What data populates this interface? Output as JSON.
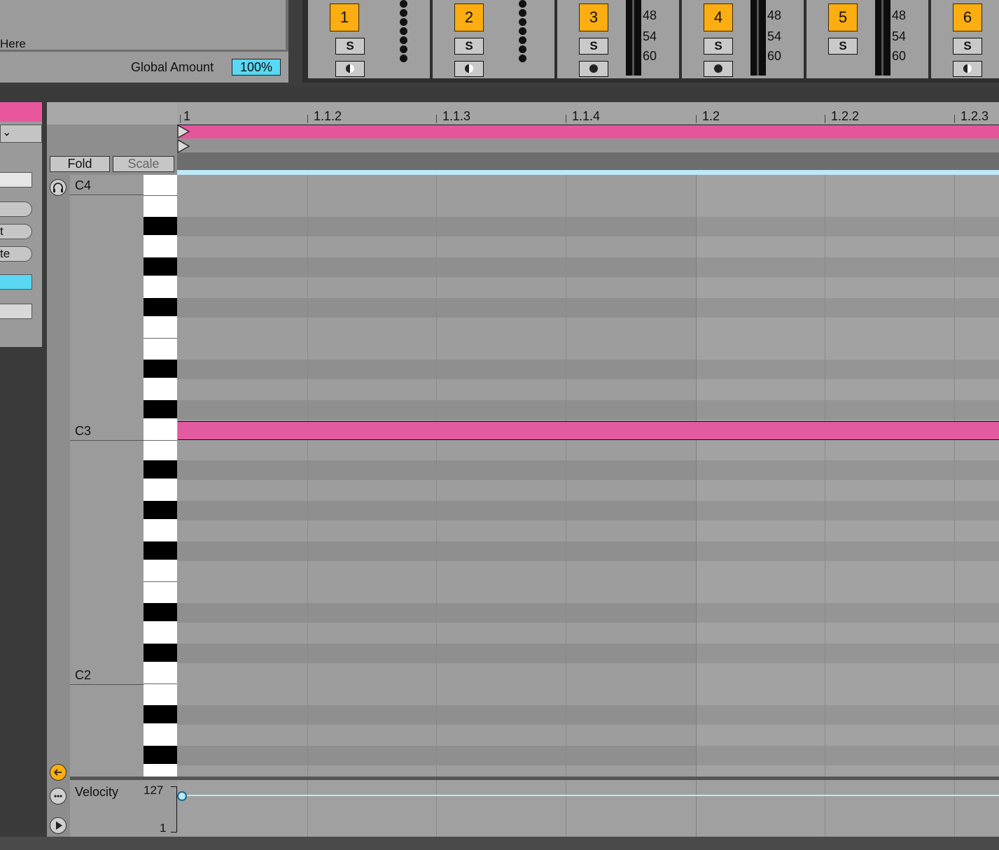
{
  "macro": {
    "partial_label": "Here",
    "global_amount_label": "Global Amount",
    "global_amount_value": "100%"
  },
  "chains": [
    {
      "number": "1",
      "solo": "S"
    },
    {
      "number": "2",
      "solo": "S"
    },
    {
      "number": "3",
      "solo": "S"
    },
    {
      "number": "4",
      "solo": "S"
    },
    {
      "number": "5",
      "solo": "S"
    },
    {
      "number": "6",
      "solo": "S"
    }
  ],
  "meter_scale": [
    "48",
    "54",
    "60"
  ],
  "left_panel": {
    "partial_ctl_1": "t",
    "partial_ctl_2": "te"
  },
  "editor": {
    "fold_label": "Fold",
    "scale_label": "Scale",
    "ruler": [
      "1",
      "1.1.2",
      "1.1.3",
      "1.1.4",
      "1.2",
      "1.2.2",
      "1.2.3"
    ],
    "octaves": [
      "C4",
      "C3",
      "C2"
    ],
    "velocity_label": "Velocity",
    "velocity_max": "127",
    "velocity_min": "1"
  },
  "colors": {
    "accent_orange": "#fbad11",
    "clip_pink": "#e5559c",
    "value_cyan": "#5ad7f2"
  }
}
